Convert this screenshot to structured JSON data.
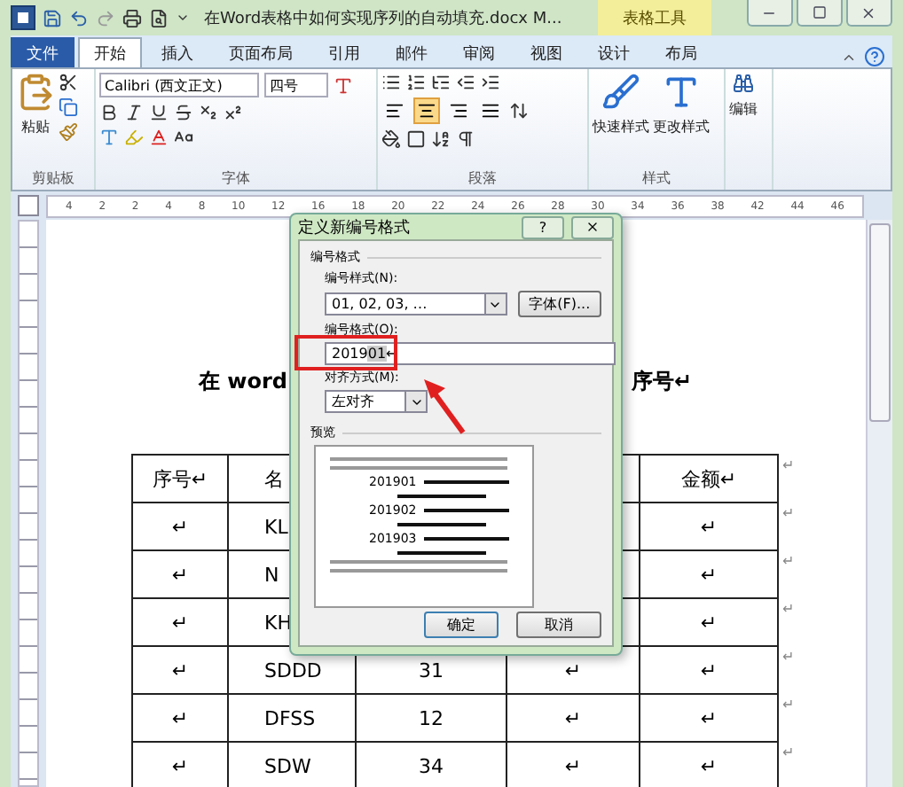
{
  "window": {
    "title": "在Word表格中如何实现序列的自动填充.docx M...",
    "context_tab": "表格工具"
  },
  "tabs": [
    {
      "label": "文件",
      "kind": "file",
      "selected": false
    },
    {
      "label": "开始",
      "kind": "normal",
      "selected": true
    },
    {
      "label": "插入",
      "kind": "normal",
      "selected": false
    },
    {
      "label": "页面布局",
      "kind": "normal",
      "selected": false
    },
    {
      "label": "引用",
      "kind": "normal",
      "selected": false
    },
    {
      "label": "邮件",
      "kind": "normal",
      "selected": false
    },
    {
      "label": "审阅",
      "kind": "normal",
      "selected": false
    },
    {
      "label": "视图",
      "kind": "normal",
      "selected": false
    },
    {
      "label": "设计",
      "kind": "context",
      "selected": false
    },
    {
      "label": "布局",
      "kind": "context",
      "selected": false
    }
  ],
  "ribbon": {
    "clipboard": {
      "paste": "粘贴",
      "label": "剪贴板"
    },
    "font": {
      "name": "Calibri (西文正文)",
      "size": "四号",
      "label": "字体"
    },
    "paragraph": {
      "label": "段落",
      "align_buttons": [
        {
          "kind": "left",
          "selected": false
        },
        {
          "kind": "center",
          "selected": true
        },
        {
          "kind": "right",
          "selected": false
        },
        {
          "kind": "justify",
          "selected": false
        }
      ]
    },
    "styles": {
      "quick": "快速样式",
      "change": "更改样式",
      "label": "样式"
    },
    "editing": {
      "label": "编辑"
    }
  },
  "ruler": [
    "4",
    "2",
    "2",
    "4",
    "8",
    "10",
    "12",
    "16",
    "18",
    "20",
    "22",
    "24",
    "26",
    "28",
    "30",
    "34",
    "36",
    "38",
    "42",
    "44",
    "46"
  ],
  "document": {
    "heading_left": "在 word",
    "heading_right": "序号↵",
    "columns": [
      {
        "label": "序号↵"
      },
      {
        "label": "名"
      },
      {},
      {},
      {
        "label": "金额↵"
      }
    ],
    "header_end": "↵",
    "rows": [
      {
        "cells": [
          {
            "text": "↵"
          },
          {
            "text": "KL"
          },
          {},
          {},
          {
            "text": "↵"
          }
        ],
        "end": "↵"
      },
      {
        "cells": [
          {
            "text": "↵"
          },
          {
            "text": "N"
          },
          {},
          {},
          {
            "text": "↵"
          }
        ],
        "end": "↵"
      },
      {
        "cells": [
          {
            "text": "↵"
          },
          {
            "text": "KH"
          },
          {},
          {},
          {
            "text": "↵"
          }
        ],
        "end": "↵"
      },
      {
        "cells": [
          {
            "text": "↵"
          },
          {
            "text": "SDDD"
          },
          {
            "text": "31"
          },
          {
            "text": "↵"
          },
          {
            "text": "↵"
          }
        ],
        "end": "↵"
      },
      {
        "cells": [
          {
            "text": "↵"
          },
          {
            "text": "DFSS"
          },
          {
            "text": "12"
          },
          {
            "text": "↵"
          },
          {
            "text": "↵"
          }
        ],
        "end": "↵"
      },
      {
        "cells": [
          {
            "text": "↵"
          },
          {
            "text": "SDW"
          },
          {
            "text": "34"
          },
          {
            "text": "↵"
          },
          {
            "text": "↵"
          }
        ],
        "end": "↵"
      }
    ]
  },
  "dialog": {
    "title": "定义新编号格式",
    "help": "?",
    "group": "编号格式",
    "style_label": "编号样式(N):",
    "style_value": "01, 02, 03, …",
    "font_button": "字体(F)...",
    "format_label": "编号格式(O):",
    "format_prefix": "2019",
    "format_field": "01",
    "format_mark": "↵",
    "align_label": "对齐方式(M):",
    "align_value": "左对齐",
    "preview_label": "预览",
    "preview_items": [
      "201901",
      "201902",
      "201903"
    ],
    "buttons": [
      {
        "label": "确定",
        "kind": "default"
      },
      {
        "label": "取消",
        "kind": "normal"
      }
    ]
  }
}
